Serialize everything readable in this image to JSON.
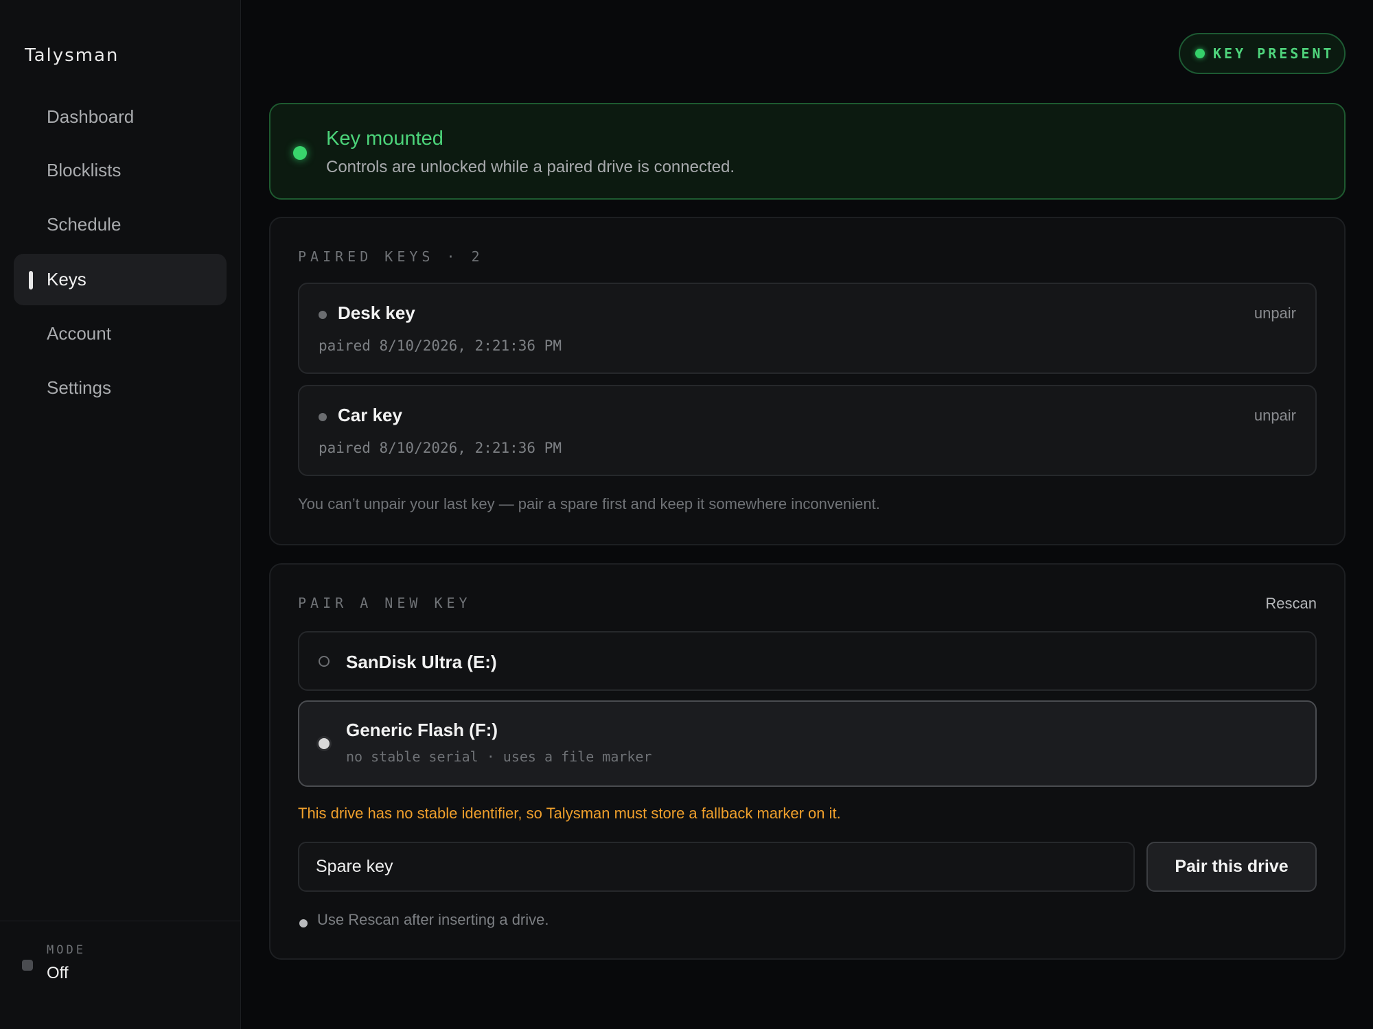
{
  "app": {
    "name": "Talysman"
  },
  "sidebar": {
    "items": [
      {
        "label": "Dashboard",
        "active": false
      },
      {
        "label": "Blocklists",
        "active": false
      },
      {
        "label": "Schedule",
        "active": false
      },
      {
        "label": "Keys",
        "active": true
      },
      {
        "label": "Account",
        "active": false
      },
      {
        "label": "Settings",
        "active": false
      }
    ],
    "mode": {
      "label": "MODE",
      "value": "Off"
    }
  },
  "header": {
    "status_badge": "KEY PRESENT"
  },
  "mounted": {
    "title": "Key mounted",
    "subtitle": "Controls are unlocked while a paired drive is connected."
  },
  "paired_keys": {
    "label": "PAIRED KEYS · 2",
    "items": [
      {
        "name": "Desk key",
        "date": "paired 8/10/2026, 2:21:36 PM",
        "action": "unpair"
      },
      {
        "name": "Car key",
        "date": "paired 8/10/2026, 2:21:36 PM",
        "action": "unpair"
      }
    ],
    "note": "You can’t unpair your last key — pair a spare first and keep it somewhere inconvenient."
  },
  "pair_new": {
    "label": "PAIR A NEW KEY",
    "rescan": "Rescan",
    "drives": [
      {
        "name": "SanDisk Ultra (E:)",
        "detail": "",
        "selected": false
      },
      {
        "name": "Generic Flash (F:)",
        "detail": "no stable serial · uses a file marker",
        "selected": true
      }
    ],
    "warning": "This drive has no stable identifier, so Talysman must store a fallback marker on it.",
    "input_value": "Spare key",
    "button": "Pair this drive",
    "hint": "Use Rescan after inserting a drive."
  },
  "colors": {
    "accent_green": "#4cd47a",
    "warning_orange": "#f0a02c",
    "background": "#08090b"
  }
}
